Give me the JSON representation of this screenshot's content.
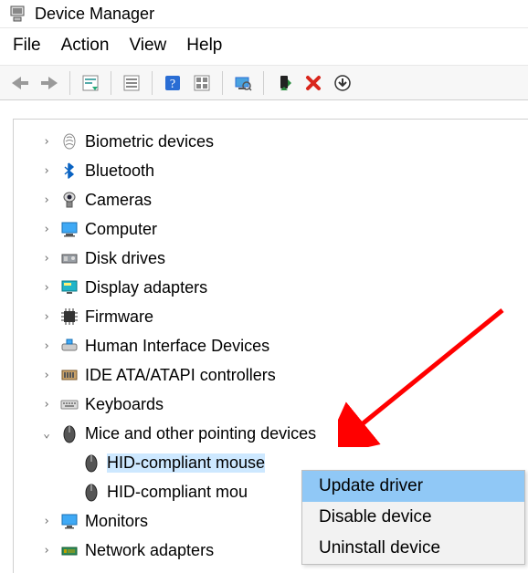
{
  "titlebar": {
    "title": "Device Manager"
  },
  "menubar": {
    "items": [
      "File",
      "Action",
      "View",
      "Help"
    ]
  },
  "toolbar": {
    "buttons": [
      "nav-back",
      "nav-forward",
      "|",
      "show-hidden",
      "|",
      "properties",
      "|",
      "help",
      "refresh",
      "|",
      "scan-hardware",
      "|",
      "enable-device",
      "remove-device",
      "install-legacy"
    ]
  },
  "tree": {
    "categories": [
      {
        "icon": "biometric-icon",
        "label": "Biometric devices",
        "expanded": false
      },
      {
        "icon": "bluetooth-icon",
        "label": "Bluetooth",
        "expanded": false
      },
      {
        "icon": "camera-icon",
        "label": "Cameras",
        "expanded": false
      },
      {
        "icon": "computer-icon",
        "label": "Computer",
        "expanded": false
      },
      {
        "icon": "diskdrive-icon",
        "label": "Disk drives",
        "expanded": false
      },
      {
        "icon": "display-icon",
        "label": "Display adapters",
        "expanded": false
      },
      {
        "icon": "firmware-icon",
        "label": "Firmware",
        "expanded": false
      },
      {
        "icon": "hid-icon",
        "label": "Human Interface Devices",
        "expanded": false
      },
      {
        "icon": "ide-icon",
        "label": "IDE ATA/ATAPI controllers",
        "expanded": false
      },
      {
        "icon": "keyboard-icon",
        "label": "Keyboards",
        "expanded": false
      },
      {
        "icon": "mouse-icon",
        "label": "Mice and other pointing devices",
        "expanded": true,
        "children": [
          {
            "icon": "mouse-icon",
            "label": "HID-compliant mouse",
            "selected": true
          },
          {
            "icon": "mouse-icon",
            "label": "HID-compliant mou",
            "selected": false
          }
        ]
      },
      {
        "icon": "monitor-icon",
        "label": "Monitors",
        "expanded": false
      },
      {
        "icon": "network-icon",
        "label": "Network adapters",
        "expanded": false
      }
    ]
  },
  "context_menu": {
    "items": [
      "Update driver",
      "Disable device",
      "Uninstall device"
    ],
    "highlighted_index": 0
  }
}
